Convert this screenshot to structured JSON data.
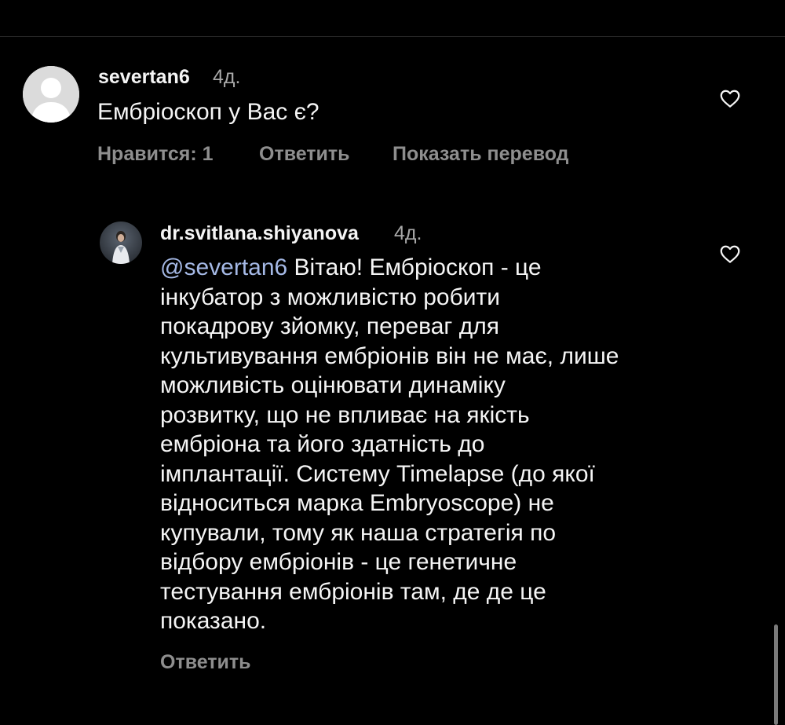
{
  "comments": [
    {
      "username": "severtan6",
      "time": "4д.",
      "text": "Ембріоскоп у Вас є?",
      "likes_label": "Нравится: 1",
      "reply_label": "Ответить",
      "translate_label": "Показать перевод",
      "avatar_icon": "default-avatar-icon"
    },
    {
      "username": "dr.svitlana.shiyanova",
      "time": "4д.",
      "mention": "@severtan6",
      "text": " Вітаю! Ембріоскоп - це\nінкубатор з можливістю робити\nпокадрову зйомку, переваг для\nкультивування ембріонів він не має, лише\nможливість оцінювати динаміку\nрозвитку, що не впливає на якість\nембріона та його здатність до\nімплантації.  Систему Timelapse (до якої\nвідноситься марка Embryoscope) не\nкупували, тому як наша стратегія по\nвідбору ембріонів - це генетичне\nтестування ембріонів там, де де це\nпоказано.",
      "reply_label": "Ответить",
      "avatar_icon": "profile-photo"
    }
  ],
  "icons": {
    "like": "heart-outline-icon"
  },
  "colors": {
    "background": "#000000",
    "text": "#f5f5f5",
    "secondary": "#8e8e8e",
    "mention": "#a5b9e6"
  }
}
